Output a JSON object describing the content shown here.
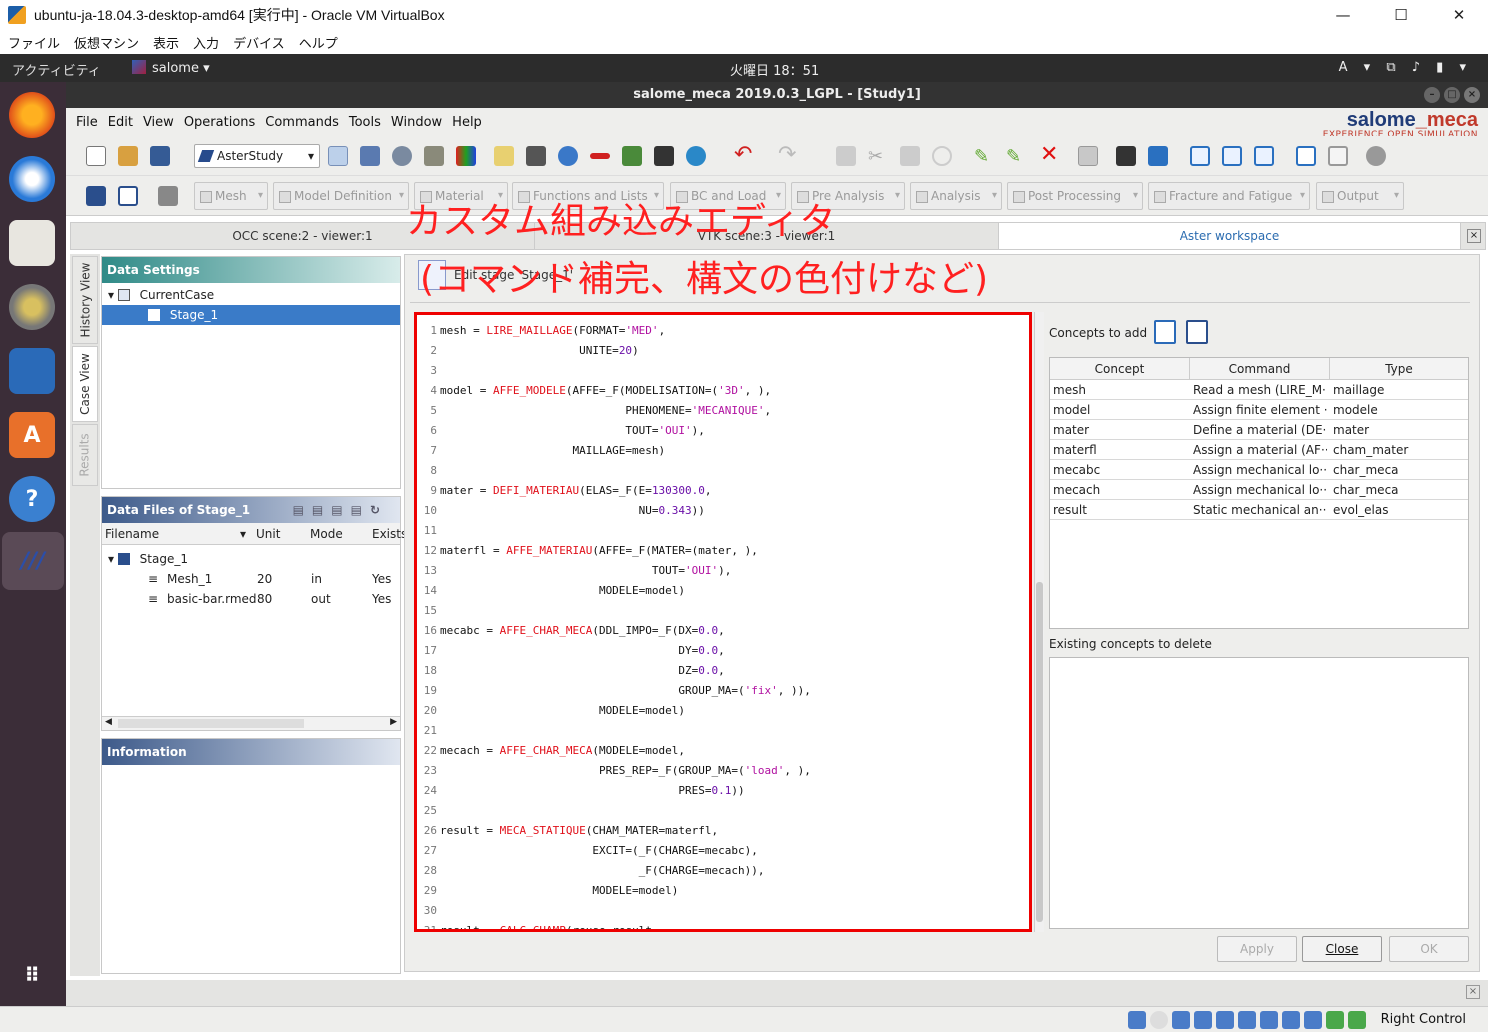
{
  "host": {
    "title": "ubuntu-ja-18.04.3-desktop-amd64 [実行中] - Oracle VM VirtualBox",
    "menu": [
      "ファイル",
      "仮想マシン",
      "表示",
      "入力",
      "デバイス",
      "ヘルプ"
    ],
    "controls": {
      "minimize": "—",
      "maximize": "☐",
      "close": "✕"
    },
    "host_key": "Right Control"
  },
  "gnome": {
    "activities": "アクティビティ",
    "app": "salome ▾",
    "clock": "火曜日 18：51",
    "tray": "A ▾  ⧉ ♪ ▮ ▾"
  },
  "window": {
    "title": "salome_meca 2019.0.3_LGPL - [Study1]",
    "menu": [
      "File",
      "Edit",
      "View",
      "Operations",
      "Commands",
      "Tools",
      "Window",
      "Help"
    ],
    "logo_main": "salome",
    "logo_accent": "_meca",
    "logo_sub": "EXPERIENCE OPEN SIMULATION",
    "module": "AsterStudy"
  },
  "categories": [
    "Mesh",
    "Model Definition",
    "Material",
    "Functions and Lists",
    "BC and Load",
    "Pre Analysis",
    "Analysis",
    "Post Processing",
    "Fracture and Fatigue",
    "Output"
  ],
  "viewer_tabs": [
    "OCC scene:2 - viewer:1",
    "VTK scene:3 - viewer:1",
    "Aster workspace"
  ],
  "side_tabs": [
    "History View",
    "Case View",
    "Results"
  ],
  "data_settings": {
    "title": "Data Settings",
    "items": [
      "CurrentCase",
      "Stage_1"
    ]
  },
  "data_files": {
    "title": "Data Files of Stage_1",
    "columns": [
      "Filename",
      "Unit",
      "Mode",
      "Exists"
    ],
    "stage": "Stage_1",
    "rows": [
      {
        "name": "Mesh_1",
        "unit": "20",
        "mode": "in",
        "exists": "Yes"
      },
      {
        "name": "basic-bar.rmed",
        "unit": "80",
        "mode": "out",
        "exists": "Yes"
      }
    ]
  },
  "information": {
    "title": "Information"
  },
  "editor": {
    "label": "Edit stage 'Stage_1'",
    "annotation_line1": "カスタム組み込みエディタ",
    "annotation_line2": "(コマンド補完、構文の色付けなど)"
  },
  "concepts": {
    "add_label": "Concepts to add",
    "columns": [
      "Concept",
      "Command",
      "Type"
    ],
    "rows": [
      {
        "concept": "mesh",
        "command": "Read a mesh (LIRE_M···",
        "type": "maillage"
      },
      {
        "concept": "model",
        "command": "Assign finite element ···",
        "type": "modele"
      },
      {
        "concept": "mater",
        "command": "Define a material (DE···",
        "type": "mater"
      },
      {
        "concept": "materfl",
        "command": "Assign a material (AF···",
        "type": "cham_mater"
      },
      {
        "concept": "mecabc",
        "command": "Assign mechanical lo···",
        "type": "char_meca"
      },
      {
        "concept": "mecach",
        "command": "Assign mechanical lo···",
        "type": "char_meca"
      },
      {
        "concept": "result",
        "command": "Static mechanical an···",
        "type": "evol_elas"
      }
    ],
    "delete_label": "Existing concepts to delete"
  },
  "buttons": {
    "apply": "Apply",
    "close": "Close",
    "ok": "OK"
  },
  "code_lines": [
    "mesh = LIRE_MAILLAGE(FORMAT='MED',",
    "                     UNITE=20)",
    "",
    "model = AFFE_MODELE(AFFE=_F(MODELISATION=('3D', ),",
    "                            PHENOMENE='MECANIQUE',",
    "                            TOUT='OUI'),",
    "                    MAILLAGE=mesh)",
    "",
    "mater = DEFI_MATERIAU(ELAS=_F(E=130300.0,",
    "                              NU=0.343))",
    "",
    "materfl = AFFE_MATERIAU(AFFE=_F(MATER=(mater, ),",
    "                                TOUT='OUI'),",
    "                        MODELE=model)",
    "",
    "mecabc = AFFE_CHAR_MECA(DDL_IMPO=_F(DX=0.0,",
    "                                    DY=0.0,",
    "                                    DZ=0.0,",
    "                                    GROUP_MA=('fix', )),",
    "                        MODELE=model)",
    "",
    "mecach = AFFE_CHAR_MECA(MODELE=model,",
    "                        PRES_REP=_F(GROUP_MA=('load', ),",
    "                                    PRES=0.1))",
    "",
    "result = MECA_STATIQUE(CHAM_MATER=materfl,",
    "                       EXCIT=(_F(CHARGE=mecabc),",
    "                              _F(CHARGE=mecach)),",
    "                       MODELE=model)",
    "",
    "result = CALC_CHAMP(reuse=result,"
  ],
  "colors": {
    "keyword": "#e0101a",
    "string": "#b010a0",
    "number": "#6a10a8",
    "annotation": "#ff2020"
  }
}
